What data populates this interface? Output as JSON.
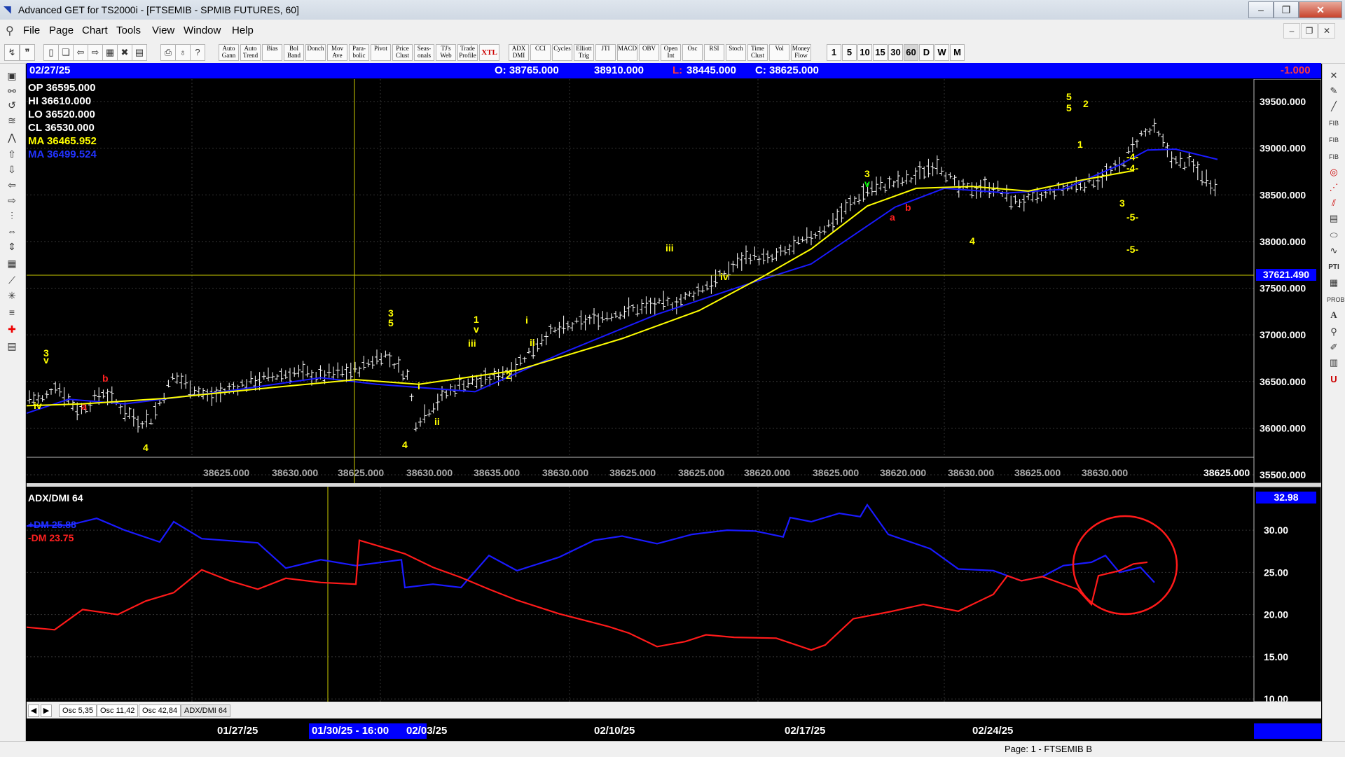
{
  "window": {
    "title": "Advanced GET for TS2000i - [FTSEMIB - SPMIB FUTURES, 60]",
    "min_label": "‒",
    "max_label": "❐",
    "close_label": "✕"
  },
  "menu": [
    "File",
    "Page",
    "Chart",
    "Tools",
    "View",
    "Window",
    "Help"
  ],
  "toolbar": {
    "studies": [
      "Auto Gann",
      "Auto Trend",
      "Bias",
      "Bol Band",
      "Donch",
      "Mov Ave",
      "Para-bolic",
      "Pivot",
      "Price Clust",
      "Seas-onals",
      "TJ's Web",
      "Trade Profile",
      "XTL",
      "ADX DMI",
      "CCI",
      "Cycles",
      "Elliott Trig",
      "JTI",
      "MACD",
      "OBV",
      "Open Int",
      "Osc",
      "RSI",
      "Stoch",
      "Time Clust",
      "Vol",
      "Money Flow"
    ],
    "timeframes": [
      "1",
      "5",
      "10",
      "15",
      "30",
      "60",
      "D",
      "W",
      "M"
    ],
    "active_timeframe": "60"
  },
  "quote": {
    "date": "02/27/25",
    "open": "O: 38765.000",
    "high": "38910.000",
    "low_label": "L:",
    "low": "38445.000",
    "close": "C: 38625.000",
    "change": "-1.000"
  },
  "ohlc_panel": {
    "op": "OP  36595.000",
    "hi": "HI   36610.000",
    "lo": "LO  36520.000",
    "cl": "CL   36530.000",
    "ma1": "MA  36465.952",
    "ma2": "MA  36499.524"
  },
  "cursor_price": "37621.490",
  "price_axis": [
    "39500.000",
    "39000.000",
    "38500.000",
    "38000.000",
    "37500.000",
    "37000.000",
    "36500.000",
    "36000.000",
    "35500.000"
  ],
  "pivot_row": [
    "38625.000",
    "38630.000",
    "38625.000",
    "38630.000",
    "38635.000",
    "38630.000",
    "38625.000",
    "38625.000",
    "38620.000",
    "38625.000",
    "38620.000",
    "38630.000",
    "38625.000",
    "38630.000",
    "38625.000"
  ],
  "oscillator": {
    "title": "ADX/DMI 64",
    "plus_dm": "+DM  25.88",
    "minus_dm": "-DM  23.75",
    "current": "32.98",
    "axis": [
      "30.00",
      "25.00",
      "20.00",
      "15.00",
      "10.00"
    ]
  },
  "tabs": [
    "Osc 5,35",
    "Osc 11,42",
    "Osc 42,84",
    "ADX/DMI 64"
  ],
  "dates": [
    "01/27/25",
    "01/30/25 - 16:00",
    "02/03/25",
    "02/10/25",
    "02/17/25",
    "02/24/25"
  ],
  "status": "Page: 1 - FTSEMIB B",
  "wave_labels": [
    "3",
    "v",
    "iv",
    "a",
    "b",
    "4",
    "3",
    "5",
    "4",
    "i",
    "ii",
    "1",
    "v",
    "iii",
    "2",
    "i",
    "ii",
    "iii",
    "iv",
    "3",
    "v",
    "a",
    "b",
    "4",
    "5",
    "5",
    "2",
    "1",
    "4",
    "4",
    "3",
    "5",
    "5"
  ],
  "colors": {
    "up_line": "#0000ff",
    "down_line": "#ff0000",
    "ma_fast": "#ffff00",
    "ma_slow": "#0000ff",
    "header": "#0000ff"
  }
}
